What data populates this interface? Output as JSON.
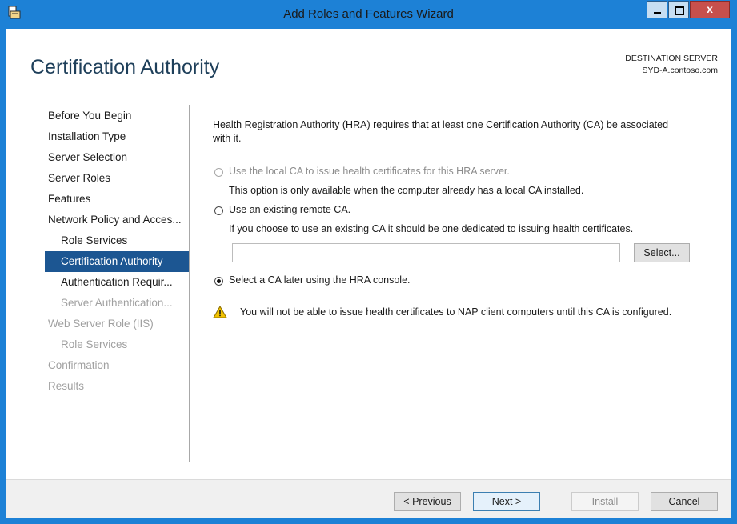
{
  "window": {
    "title": "Add Roles and Features Wizard",
    "close_glyph": "x"
  },
  "header": {
    "page_title": "Certification Authority",
    "destination_label": "DESTINATION SERVER",
    "destination_value": "SYD-A.contoso.com"
  },
  "nav": {
    "items": [
      {
        "label": "Before You Begin"
      },
      {
        "label": "Installation Type"
      },
      {
        "label": "Server Selection"
      },
      {
        "label": "Server Roles"
      },
      {
        "label": "Features"
      },
      {
        "label": "Network Policy and Acces..."
      },
      {
        "label": "Role Services"
      },
      {
        "label": "Certification Authority"
      },
      {
        "label": "Authentication Requir..."
      },
      {
        "label": "Server Authentication..."
      },
      {
        "label": "Web Server Role (IIS)"
      },
      {
        "label": "Role Services"
      },
      {
        "label": "Confirmation"
      },
      {
        "label": "Results"
      }
    ]
  },
  "main": {
    "intro": "Health Registration Authority (HRA) requires that at least one Certification Authority (CA) be associated with it.",
    "option_local": "Use the local CA to issue health certificates for this HRA server.",
    "option_local_note": "This option is only available when the computer already has a local CA installed.",
    "option_remote": "Use an existing remote CA.",
    "option_remote_note": "If you choose to use an existing CA it should be one dedicated to issuing health certificates.",
    "ca_input_value": "",
    "select_button": "Select...",
    "option_later": "Select a CA later using the HRA console.",
    "warning": "You will not be able to issue health certificates to NAP client computers until this CA is configured.",
    "selected_option": "later"
  },
  "footer": {
    "previous": "< Previous",
    "next": "Next >",
    "install": "Install",
    "cancel": "Cancel"
  },
  "colors": {
    "titlebar": "#1d81d6",
    "nav_selected": "#1c5692",
    "title_text": "#1e3f5a"
  }
}
